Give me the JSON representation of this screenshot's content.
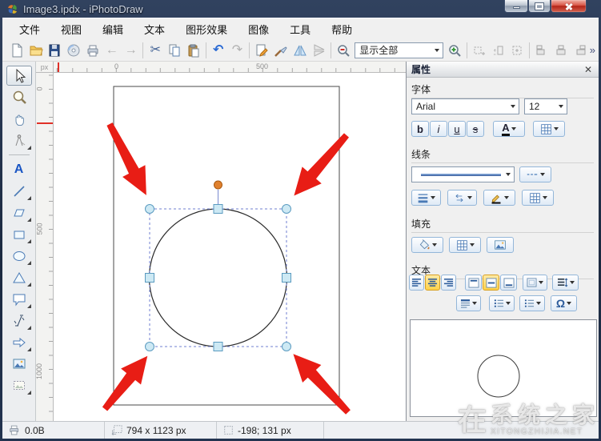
{
  "window": {
    "title": "Image3.ipdx - iPhotoDraw"
  },
  "menu": {
    "items": [
      "文件",
      "视图",
      "编辑",
      "文本",
      "图形效果",
      "图像",
      "工具",
      "帮助"
    ]
  },
  "toolbar": {
    "view_combo_value": "显示全部"
  },
  "icons": {
    "cut": "✂",
    "back": "←",
    "forward": "→",
    "undo": "↶",
    "redo": "↷",
    "overflow": "»",
    "text_tool": "A"
  },
  "rulers": {
    "unit": "px",
    "top": [
      "0",
      "500"
    ],
    "left": [
      "0",
      "500",
      "1000"
    ]
  },
  "panel": {
    "title": "属性",
    "close_glyph": "✕",
    "sections": {
      "font": "字体",
      "line": "线条",
      "fill": "填充",
      "text": "文本"
    },
    "font": {
      "family": "Arial",
      "size": "12",
      "bold": "b",
      "italic": "i",
      "underline": "u",
      "strike": "s",
      "color_glyph": "A"
    },
    "text": {
      "omega": "Ω"
    }
  },
  "statusbar": {
    "file_size": "0.0B",
    "image_size": "794 x 1123 px",
    "cursor_pos": "-198; 131 px"
  },
  "watermark": {
    "logo": "在",
    "title": "系统之家",
    "site": "XITONGZHIJIA.NET"
  },
  "colors": {
    "selection_handle": "#cde9f4",
    "handle_border": "#5b9bc0",
    "rotation_handle": "#e0812e",
    "arrow_red": "#e81d15",
    "active_yellow": "#ffd24a",
    "titlebar_navy": "#1b2940"
  }
}
